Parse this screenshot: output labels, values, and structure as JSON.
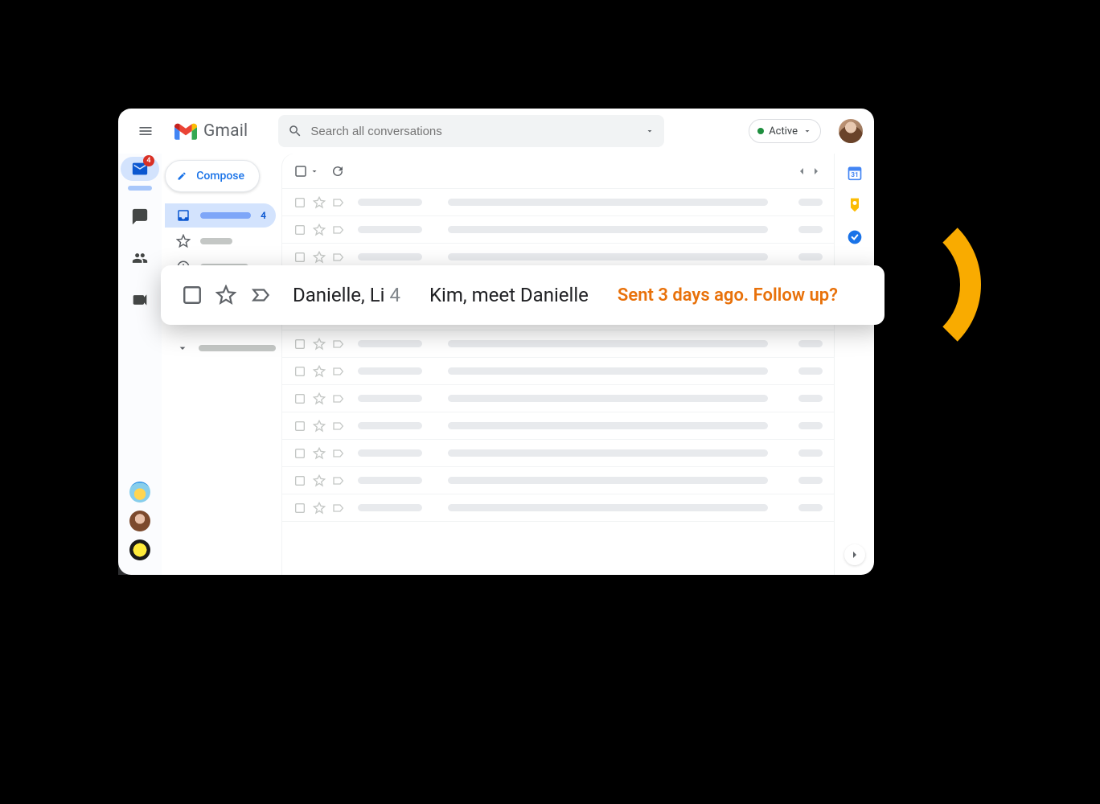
{
  "header": {
    "app_name": "Gmail",
    "search_placeholder": "Search all conversations",
    "status_label": "Active"
  },
  "rail": {
    "mail_badge": "4"
  },
  "sidebar": {
    "compose_label": "Compose",
    "inbox_count": "4"
  },
  "highlighted_email": {
    "sender": "Danielle, Li",
    "thread_count": "4",
    "subject": "Kim, meet Danielle",
    "nudge": "Sent 3 days ago. Follow up?"
  }
}
